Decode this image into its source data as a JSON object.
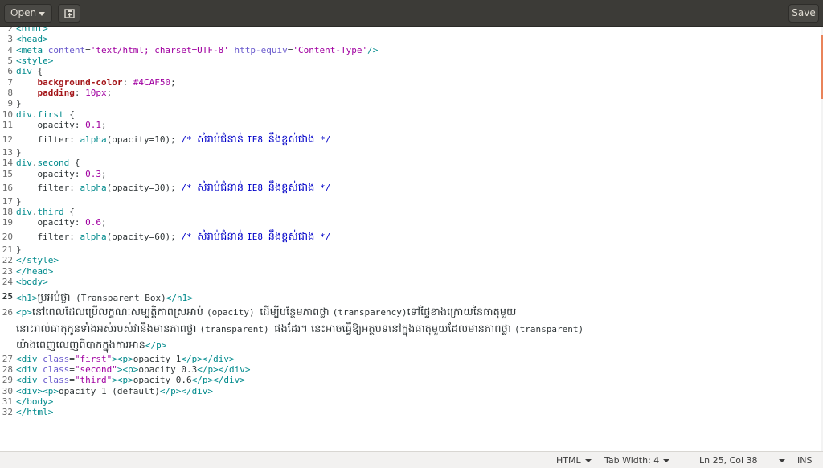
{
  "header": {
    "open_label": "Open",
    "new_icon": "new-document-icon",
    "save_label": "Save"
  },
  "editor": {
    "lines": [
      {
        "n": "2",
        "segs": [
          [
            "tag",
            "<html>"
          ]
        ]
      },
      {
        "n": "3",
        "segs": [
          [
            "tag",
            "<head>"
          ]
        ]
      },
      {
        "n": "4",
        "segs": [
          [
            "tag",
            "<meta "
          ],
          [
            "attr",
            "content"
          ],
          [
            "plain",
            "="
          ],
          [
            "str",
            "'text/html; charset=UTF-8'"
          ],
          [
            "plain",
            " "
          ],
          [
            "attr",
            "http-equiv"
          ],
          [
            "plain",
            "="
          ],
          [
            "str",
            "'Content-Type'"
          ],
          [
            "tag",
            "/>"
          ]
        ]
      },
      {
        "n": "5",
        "segs": [
          [
            "tag",
            "<style>"
          ]
        ]
      },
      {
        "n": "6",
        "segs": [
          [
            "sel",
            "div"
          ],
          [
            "plain",
            " {"
          ]
        ]
      },
      {
        "n": "7",
        "segs": [
          [
            "plain",
            "    "
          ],
          [
            "prop",
            "background-color"
          ],
          [
            "plain",
            ": "
          ],
          [
            "val",
            "#4CAF50"
          ],
          [
            "plain",
            ";"
          ]
        ]
      },
      {
        "n": "8",
        "segs": [
          [
            "plain",
            "    "
          ],
          [
            "prop",
            "padding"
          ],
          [
            "plain",
            ": "
          ],
          [
            "val",
            "10px"
          ],
          [
            "plain",
            ";"
          ]
        ]
      },
      {
        "n": "9",
        "segs": [
          [
            "plain",
            "}"
          ]
        ]
      },
      {
        "n": "10",
        "segs": [
          [
            "sel",
            "div"
          ],
          [
            "plain",
            "."
          ],
          [
            "sel",
            "first"
          ],
          [
            "plain",
            " {"
          ]
        ]
      },
      {
        "n": "11",
        "segs": [
          [
            "plain",
            "    opacity: "
          ],
          [
            "val",
            "0.1"
          ],
          [
            "plain",
            ";"
          ]
        ]
      },
      {
        "n": "12",
        "tall": true,
        "segs": [
          [
            "plain",
            "    filter: "
          ],
          [
            "fn",
            "alpha"
          ],
          [
            "plain",
            "(opacity=10); "
          ],
          [
            "cmt",
            "/* "
          ],
          [
            "cmtk",
            "សំរាប់ជំនាន់ "
          ],
          [
            "cmt",
            "IE8 "
          ],
          [
            "cmtk",
            "នឹងខ្ពស់ជាង"
          ],
          [
            "cmt",
            " */"
          ]
        ]
      },
      {
        "n": "13",
        "segs": [
          [
            "plain",
            "}"
          ]
        ]
      },
      {
        "n": "14",
        "segs": [
          [
            "sel",
            "div"
          ],
          [
            "plain",
            "."
          ],
          [
            "sel",
            "second"
          ],
          [
            "plain",
            " {"
          ]
        ]
      },
      {
        "n": "15",
        "segs": [
          [
            "plain",
            "    opacity: "
          ],
          [
            "val",
            "0.3"
          ],
          [
            "plain",
            ";"
          ]
        ]
      },
      {
        "n": "16",
        "tall": true,
        "segs": [
          [
            "plain",
            "    filter: "
          ],
          [
            "fn",
            "alpha"
          ],
          [
            "plain",
            "(opacity=30); "
          ],
          [
            "cmt",
            "/* "
          ],
          [
            "cmtk",
            "សំរាប់ជំនាន់ "
          ],
          [
            "cmt",
            "IE8 "
          ],
          [
            "cmtk",
            "នឹងខ្ពស់ជាង"
          ],
          [
            "cmt",
            " */"
          ]
        ]
      },
      {
        "n": "17",
        "segs": [
          [
            "plain",
            "}"
          ]
        ]
      },
      {
        "n": "18",
        "segs": [
          [
            "sel",
            "div"
          ],
          [
            "plain",
            "."
          ],
          [
            "sel",
            "third"
          ],
          [
            "plain",
            " {"
          ]
        ]
      },
      {
        "n": "19",
        "segs": [
          [
            "plain",
            "    opacity: "
          ],
          [
            "val",
            "0.6"
          ],
          [
            "plain",
            ";"
          ]
        ]
      },
      {
        "n": "20",
        "tall": true,
        "segs": [
          [
            "plain",
            "    filter: "
          ],
          [
            "fn",
            "alpha"
          ],
          [
            "plain",
            "(opacity=60); "
          ],
          [
            "cmt",
            "/* "
          ],
          [
            "cmtk",
            "សំរាប់ជំនាន់ "
          ],
          [
            "cmt",
            "IE8 "
          ],
          [
            "cmtk",
            "នឹងខ្ពស់ជាង"
          ],
          [
            "cmt",
            " */"
          ]
        ]
      },
      {
        "n": "21",
        "segs": [
          [
            "plain",
            "}"
          ]
        ]
      },
      {
        "n": "22",
        "segs": [
          [
            "tag",
            "</style>"
          ]
        ]
      },
      {
        "n": "23",
        "segs": [
          [
            "tag",
            "</head>"
          ]
        ]
      },
      {
        "n": "24",
        "segs": [
          [
            "tag",
            "<body>"
          ]
        ]
      },
      {
        "n": "25",
        "tall": true,
        "current": true,
        "segs": [
          [
            "tag",
            "<h1>"
          ],
          [
            "kh",
            "ប្រអប់ថ្លា"
          ],
          [
            "plain",
            " (Transparent Box)"
          ],
          [
            "tag",
            "</h1>"
          ],
          [
            "cursor",
            ""
          ]
        ]
      },
      {
        "n": "26",
        "tall": true,
        "segs": [
          [
            "tag",
            "<p>"
          ],
          [
            "kh",
            "នៅពេលដែលប្រើលក្ខណៈសម្បត្តិភាពស្រអាប់ "
          ],
          [
            "plain",
            "(opacity) "
          ],
          [
            "kh",
            "ដើម្បីបន្ថែមភាពថ្លា "
          ],
          [
            "plain",
            "(transparency)"
          ],
          [
            "kh",
            "ទៅផ្ទៃខាងក្រោយនៃធាតុមួយ"
          ]
        ]
      },
      {
        "n": "",
        "tall": true,
        "segs": [
          [
            "kh",
            "នោះរាល់ធាតុកូនទាំងអស់របស់វានឹងមានភាពថ្លា "
          ],
          [
            "plain",
            "(transparent) "
          ],
          [
            "kh",
            "ផងដែរ។ នេះអាចធ្វើឱ្យអត្ថបទនៅក្នុងធាតុមួយដែលមានភាពថ្លា "
          ],
          [
            "plain",
            "(transparent)"
          ]
        ]
      },
      {
        "n": "",
        "tall": true,
        "segs": [
          [
            "kh",
            "យ៉ាងពេញលេញពិបាកក្នុងការអាន"
          ],
          [
            "tag",
            "</p>"
          ]
        ]
      },
      {
        "n": "27",
        "segs": [
          [
            "tag",
            "<div "
          ],
          [
            "attr",
            "class"
          ],
          [
            "plain",
            "="
          ],
          [
            "str",
            "\"first\""
          ],
          [
            "tag",
            ">"
          ],
          [
            "tag",
            "<p>"
          ],
          [
            "plain",
            "opacity 1"
          ],
          [
            "tag",
            "</p></div>"
          ]
        ]
      },
      {
        "n": "28",
        "segs": [
          [
            "tag",
            "<div "
          ],
          [
            "attr",
            "class"
          ],
          [
            "plain",
            "="
          ],
          [
            "str",
            "\"second\""
          ],
          [
            "tag",
            ">"
          ],
          [
            "tag",
            "<p>"
          ],
          [
            "plain",
            "opacity 0.3"
          ],
          [
            "tag",
            "</p></div>"
          ]
        ]
      },
      {
        "n": "29",
        "segs": [
          [
            "tag",
            "<div "
          ],
          [
            "attr",
            "class"
          ],
          [
            "plain",
            "="
          ],
          [
            "str",
            "\"third\""
          ],
          [
            "tag",
            ">"
          ],
          [
            "tag",
            "<p>"
          ],
          [
            "plain",
            "opacity 0.6"
          ],
          [
            "tag",
            "</p></div>"
          ]
        ]
      },
      {
        "n": "30",
        "segs": [
          [
            "tag",
            "<div><p>"
          ],
          [
            "plain",
            "opacity 1 (default)"
          ],
          [
            "tag",
            "</p></div>"
          ]
        ]
      },
      {
        "n": "31",
        "segs": [
          [
            "tag",
            "</body>"
          ]
        ]
      },
      {
        "n": "32",
        "segs": [
          [
            "tag",
            "</html>"
          ]
        ]
      }
    ]
  },
  "statusbar": {
    "language": "HTML",
    "tab_width": "Tab Width: 4",
    "position": "Ln 25, Col 38",
    "mode": "INS"
  },
  "colors": {
    "headerbar": "#3c3b37",
    "tag": "#008a8c",
    "attribute": "#6a5acd",
    "string": "#a000a0",
    "property": "#a4161a",
    "comment": "#0000c8"
  }
}
